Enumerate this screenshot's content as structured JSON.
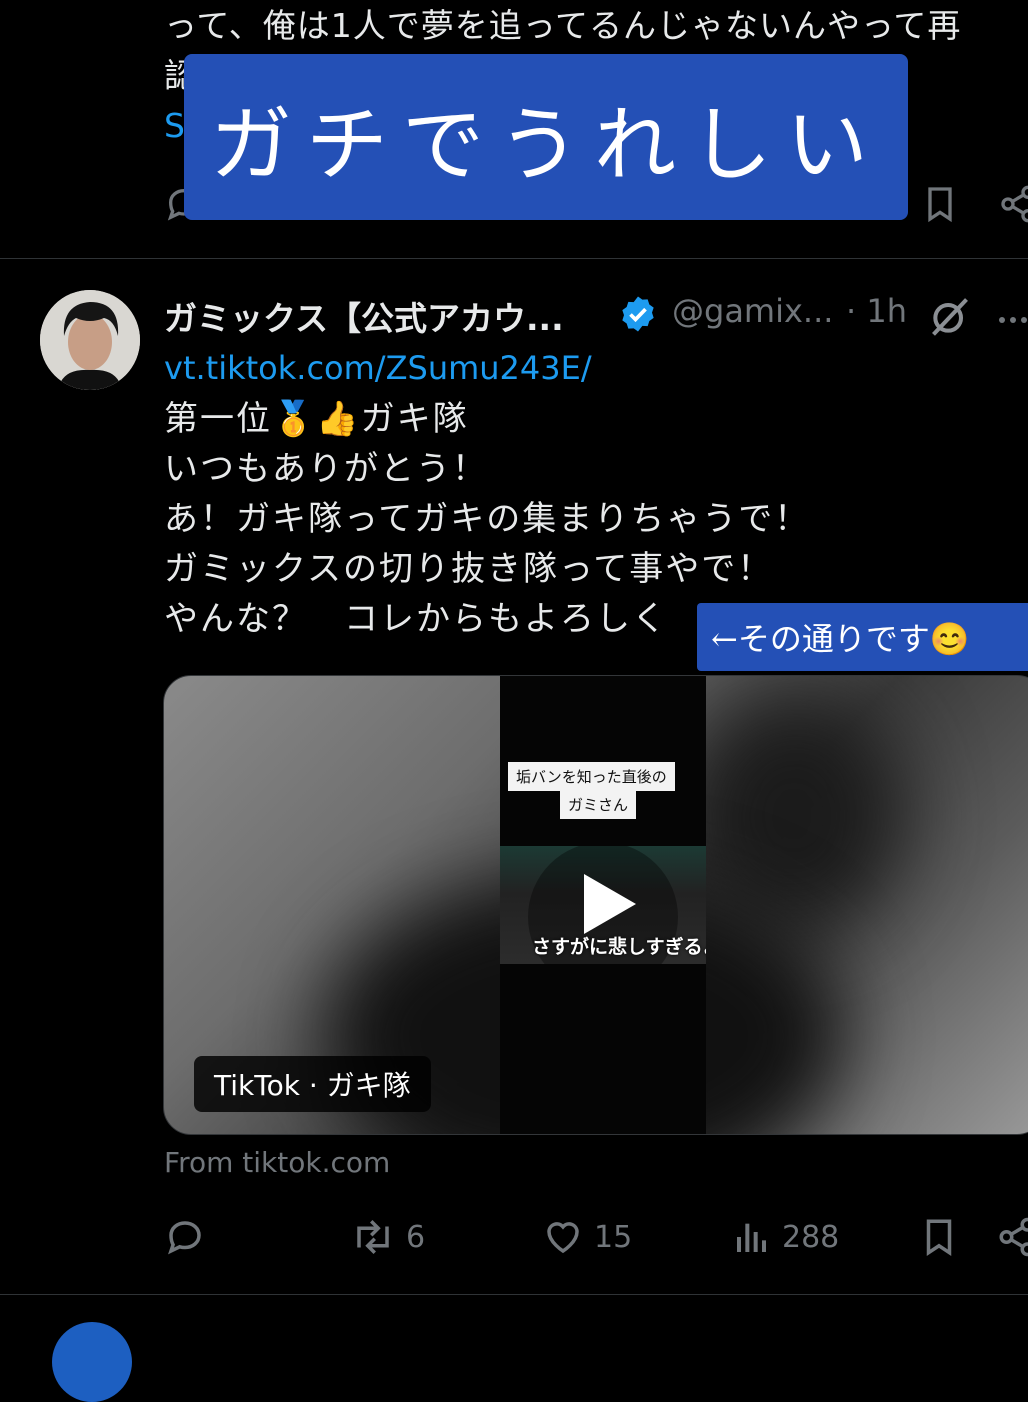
{
  "prev_tweet": {
    "text_line1": "って、俺は1人で夢を追ってるんじゃないんやって再",
    "text_line2": "認",
    "link_fragment": "S"
  },
  "overlay_caption": "ガチでうれしい",
  "tweet": {
    "author_name": "ガミックス【公式アカウ...",
    "handle": "@gamix...",
    "time": "· 1h",
    "link": "vt.tiktok.com/ZSumu243E/",
    "lines": [
      "第一位🥇👍ガキ隊",
      "いつもありがとう！",
      "あ！ガキ隊ってガキの集まりちゃうで！",
      "ガミックスの切り抜き隊って事やで！",
      "やんな？　コレからもよろしく"
    ],
    "media": {
      "caption_line1": "垢バンを知った直後の",
      "caption_line2": "ガミさん",
      "thumb_subtitle": "さすがに悲しすぎるよ",
      "label": "TikTok · ガキ隊"
    },
    "source": "From tiktok.com",
    "actions": {
      "retweets": "6",
      "likes": "15",
      "views": "288"
    }
  },
  "note_caption": "←その通りです😊",
  "colors": {
    "background": "#000000",
    "accent_blue": "#1d9bf0",
    "overlay_blue": "#2450b6",
    "muted": "#71767b",
    "verified": "#1d9bf0"
  }
}
